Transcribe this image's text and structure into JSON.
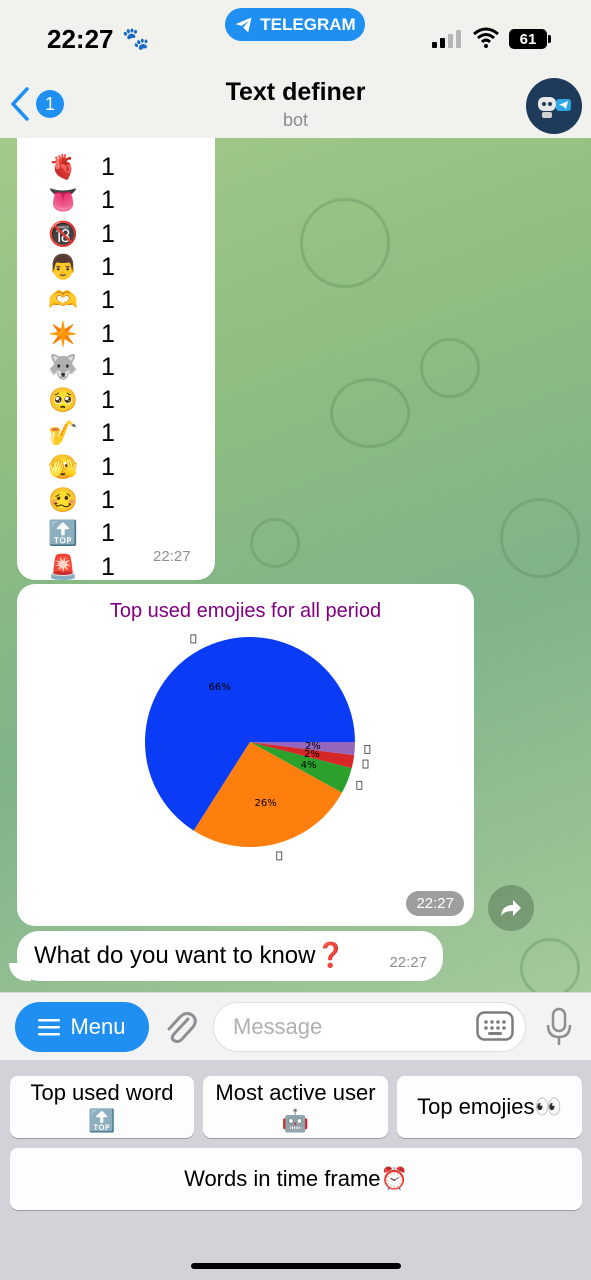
{
  "status": {
    "time": "22:27",
    "battery": "61",
    "app_pill": "TELEGRAM"
  },
  "header": {
    "back_count": "1",
    "title": "Text definer",
    "subtitle": "bot"
  },
  "emoji_list": {
    "rows": [
      {
        "emoji": "🫀",
        "count": "1"
      },
      {
        "emoji": "👅",
        "count": "1"
      },
      {
        "emoji": "🔞",
        "count": "1"
      },
      {
        "emoji": "👨",
        "count": "1"
      },
      {
        "emoji": "🫶",
        "count": "1"
      },
      {
        "emoji": "✴️",
        "count": "1"
      },
      {
        "emoji": "🐺",
        "count": "1"
      },
      {
        "emoji": "🥺",
        "count": "1"
      },
      {
        "emoji": "🎷",
        "count": "1"
      },
      {
        "emoji": "🫣",
        "count": "1"
      },
      {
        "emoji": "🥴",
        "count": "1"
      },
      {
        "emoji": "🔝",
        "count": "1"
      },
      {
        "emoji": "🚨",
        "count": "1"
      }
    ],
    "time": "22:27"
  },
  "chart_message": {
    "time": "22:27"
  },
  "chart_data": {
    "type": "pie",
    "title": "Top used emojies for all period",
    "slices": [
      {
        "label": "66%",
        "value": 66,
        "color": "#0b3cf5"
      },
      {
        "label": "26%",
        "value": 26,
        "color": "#ff7f0e"
      },
      {
        "label": "4%",
        "value": 4,
        "color": "#2ca02c"
      },
      {
        "label": "2%",
        "value": 2,
        "color": "#d62728"
      },
      {
        "label": "2%",
        "value": 2,
        "color": "#9467bd"
      }
    ]
  },
  "text_message": {
    "text": "What do you want to know❓",
    "time": "22:27"
  },
  "input": {
    "menu_label": "Menu",
    "placeholder": "Message"
  },
  "keyboard": {
    "top_used_word": "Top used word 🔝",
    "most_active_user": "Most active user 🤖",
    "top_emojies": "Top emojies👀",
    "words_in_time_frame": "Words in time frame⏰"
  },
  "colors": {
    "accent": "#1f8ff1",
    "chart_title": "#800080"
  }
}
